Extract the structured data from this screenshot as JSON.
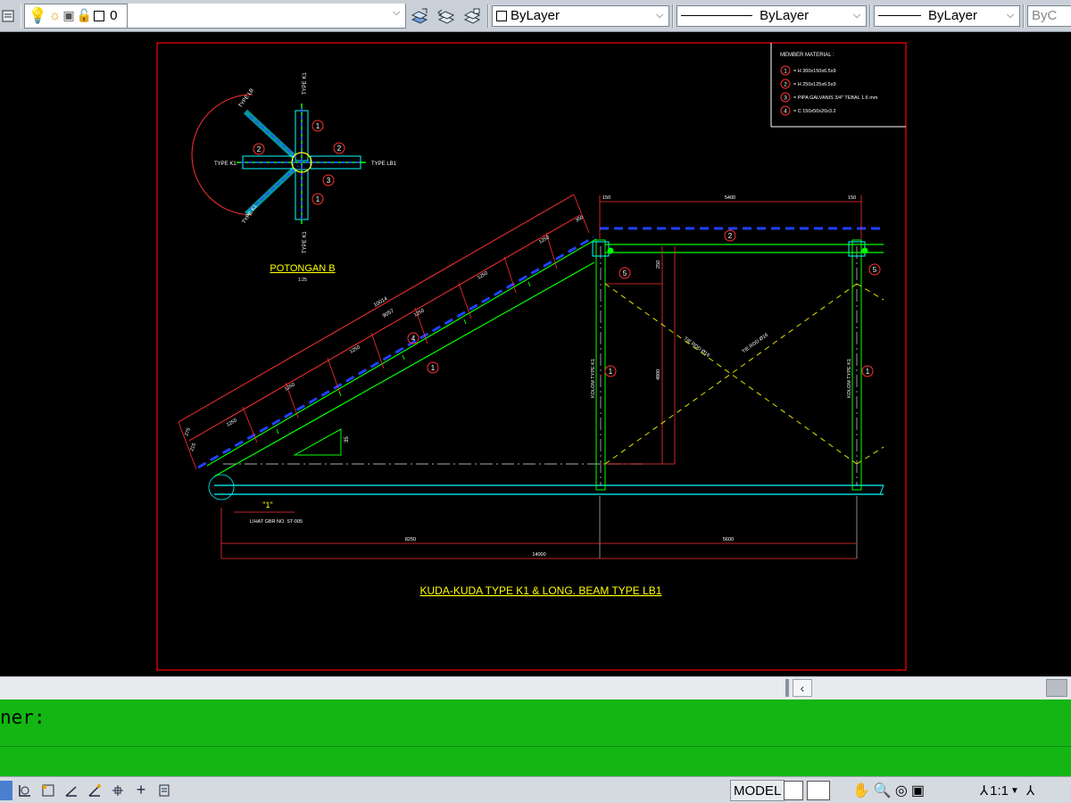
{
  "toolbar": {
    "layer_name": "0",
    "color": "ByLayer",
    "linetype": "ByLayer",
    "lineweight": "ByLayer",
    "plotstyle": "ByC"
  },
  "drawing": {
    "title": "KUDA-KUDA TYPE K1 & LONG. BEAM TYPE LB1",
    "section_title": "POTONGAN B",
    "section_scale": "1:25",
    "material_title": "MEMBER MATERIAL :",
    "materials": [
      {
        "no": "1",
        "desc": "= H 300x150x6.5x9"
      },
      {
        "no": "2",
        "desc": "= H 250x125x6.5x9"
      },
      {
        "no": "3",
        "desc": "= PIPA GALVANIS 3/4\" TEBAL 1.6  mm"
      },
      {
        "no": "4",
        "desc": "= C 150x50x20x3.2"
      }
    ],
    "section_labels": {
      "top": "TYPE K1",
      "bottom": "TYPE K1",
      "left": "TYPE K1",
      "right": "TYPE LB1",
      "diag_top": "TYPE LB",
      "diag_bottom": "TYPE K1"
    },
    "detail_label": "\"1\"",
    "detail_note": "LIHAT GBR NO. ST-005",
    "dims": {
      "bottom_left": "8250",
      "bottom_right": "5600",
      "bottom_total": "14000",
      "top_left": "150",
      "top_mid": "5400",
      "top_right": "150",
      "col_height": "4800",
      "slope_total": "10014",
      "slope_segs": [
        "1250",
        "1250",
        "1250",
        "1250",
        "1250",
        "1250",
        "1250"
      ],
      "slope_small": [
        "275",
        "215"
      ],
      "slope_mid": "9057",
      "angle": "35",
      "eave": "350",
      "cross_dim": "250",
      "brace1": "TIE ROD Ø16",
      "brace2": "TIE ROD Ø16"
    },
    "column_label": "KOLOM TYPE K1"
  },
  "command": {
    "history_line": "ner:",
    "input_value": ""
  },
  "status": {
    "model_label": "MODEL",
    "scale_label": "1:1"
  }
}
